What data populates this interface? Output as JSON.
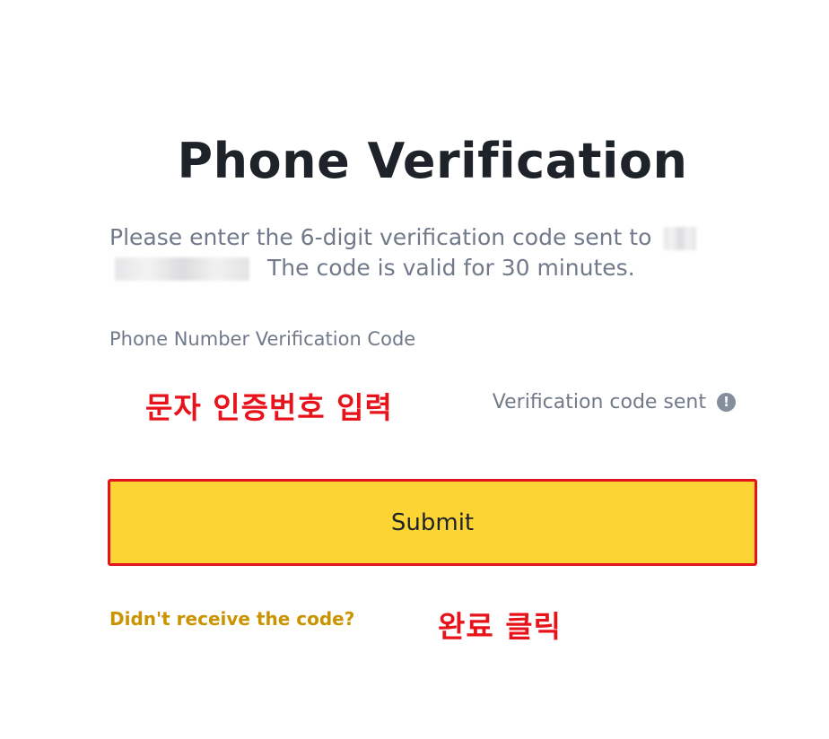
{
  "page": {
    "title": "Phone Verification",
    "description_line1": "Please enter the 6-digit verification code sent to",
    "description_line2": "The code is valid for 30 minutes."
  },
  "form": {
    "code_label": "Phone Number Verification Code",
    "code_value": "",
    "sent_status": "Verification code sent",
    "submit_label": "Submit",
    "resend_link": "Didn't receive the code?"
  },
  "annotations": {
    "input_hint": "문자 인증번호 입력",
    "submit_hint": "완료 클릭"
  },
  "icons": {
    "info": "info-icon"
  },
  "colors": {
    "submit_bg": "#fcd535",
    "link": "#c99400",
    "annotation_red": "#e8121a"
  }
}
